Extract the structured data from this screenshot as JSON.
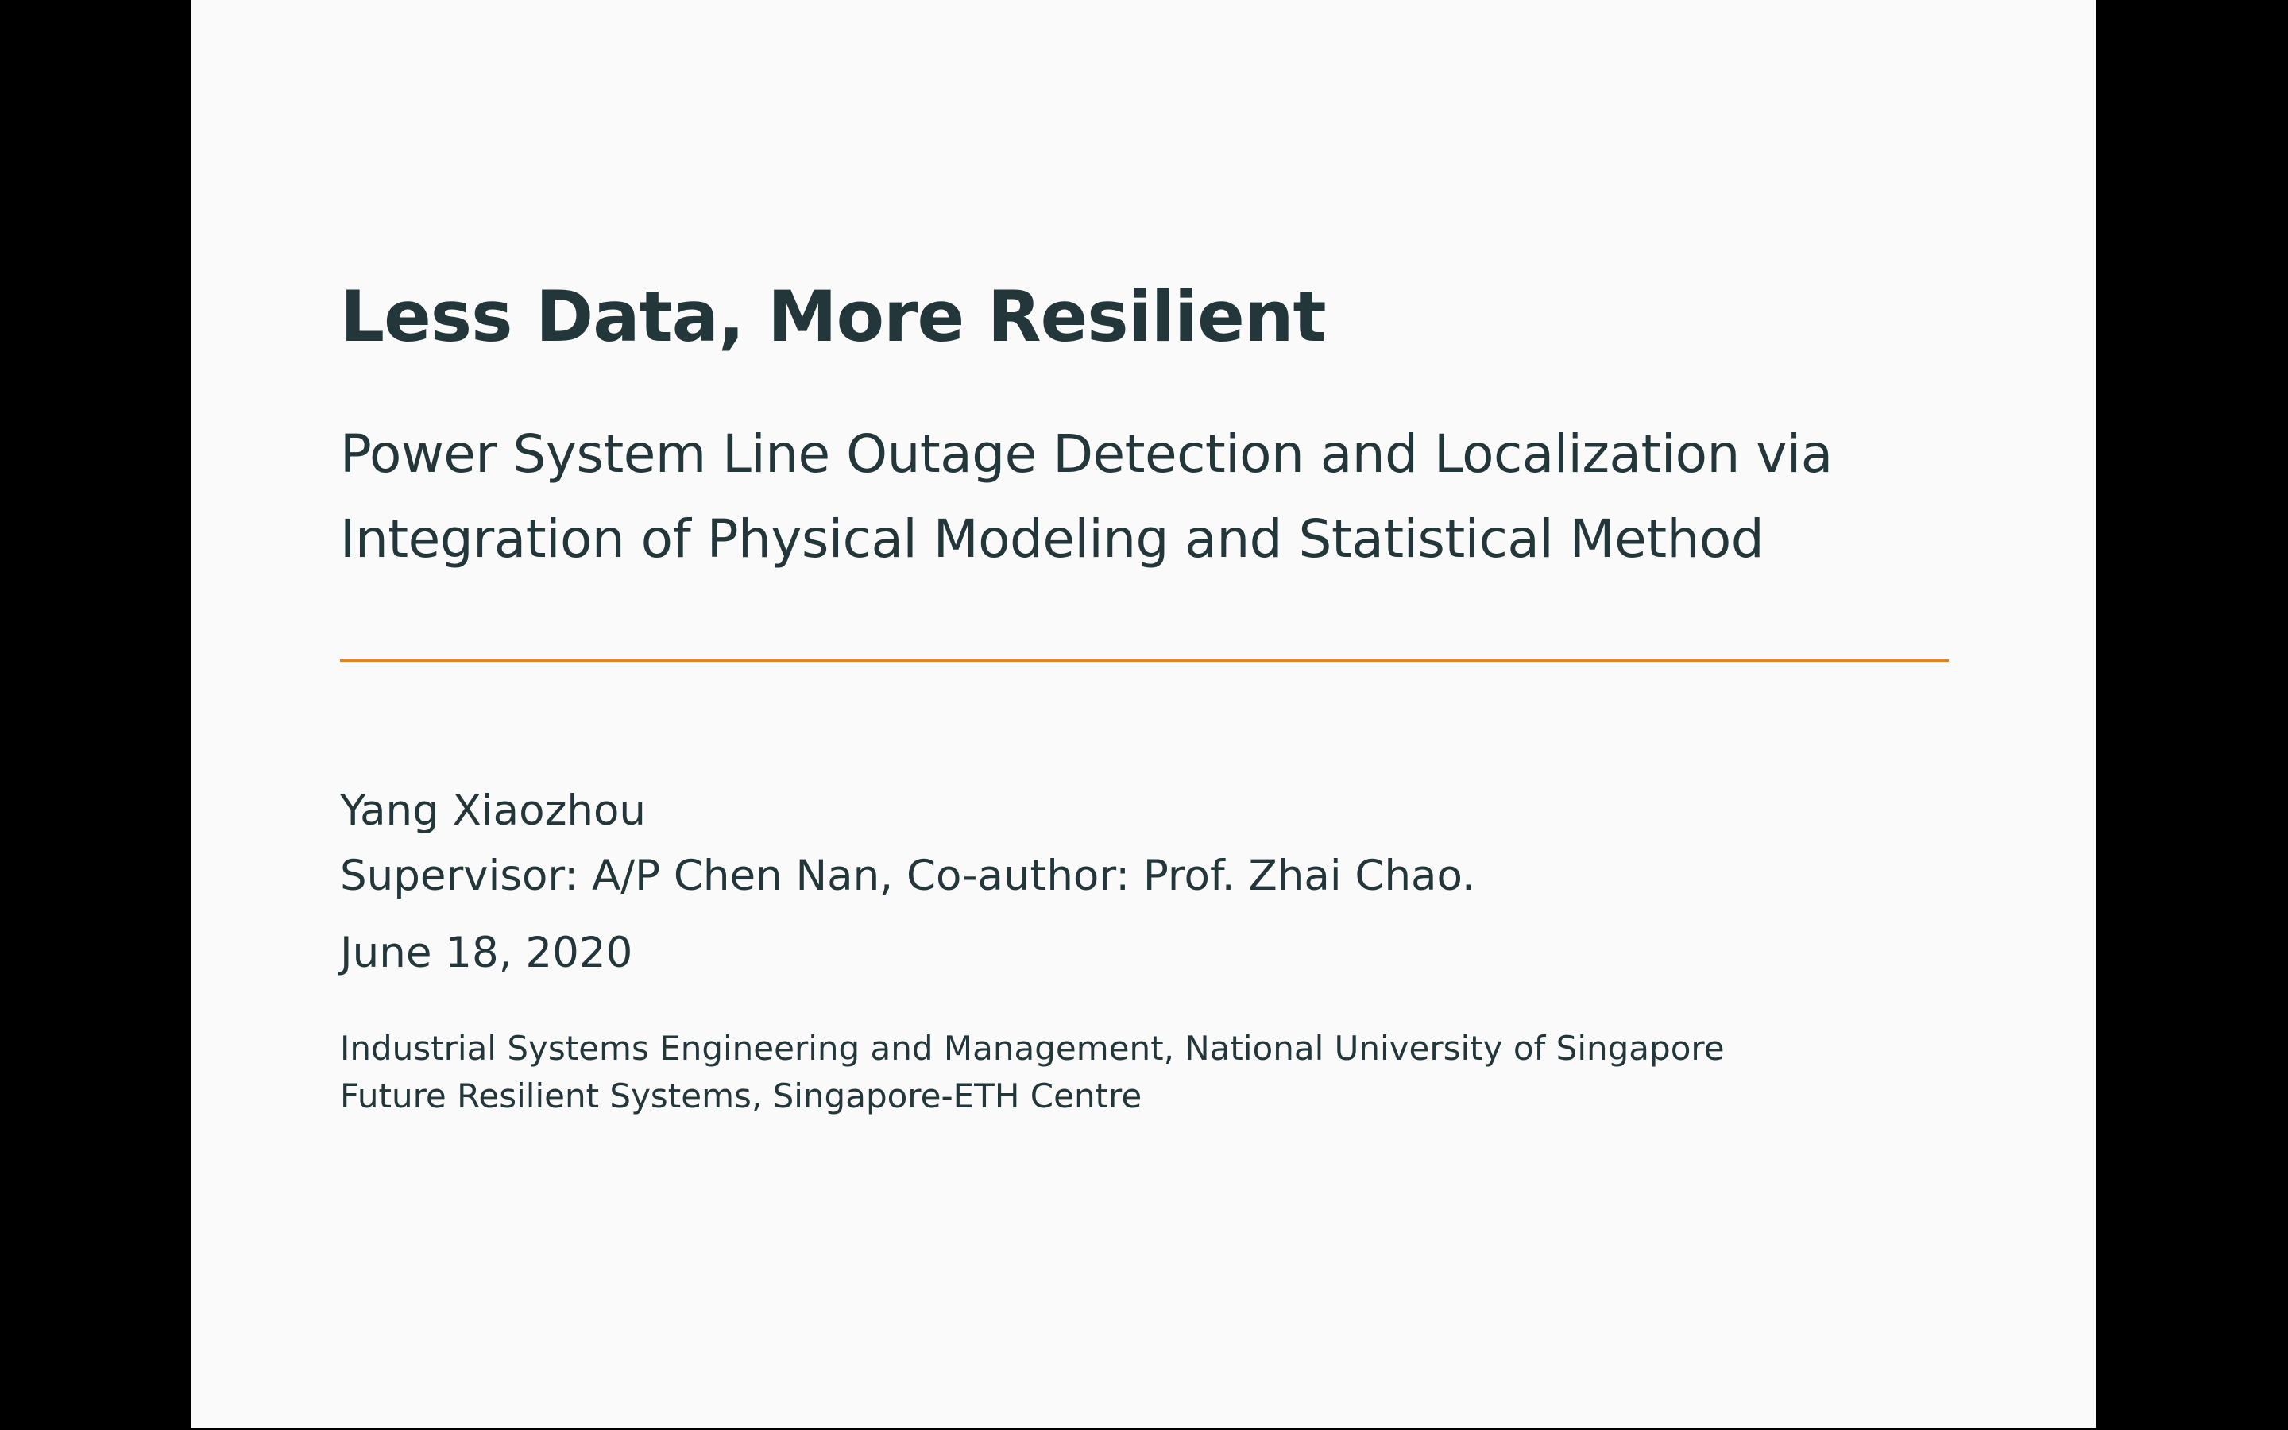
{
  "slide": {
    "title": "Less Data, More Resilient",
    "subtitle_lines": [
      "Power System Line Outage Detection and Localization via",
      "Integration of Physical Modeling and Statistical Method"
    ],
    "author": "Yang Xiaozhou",
    "supervisor": "Supervisor: A/P Chen Nan, Co-author: Prof. Zhai Chao.",
    "date": "June 18, 2020",
    "institute_lines": [
      "Industrial Systems Engineering and Management, National University of Singapore",
      "Future Resilient Systems, Singapore-ETH Centre"
    ]
  },
  "colors": {
    "background": "#fafafa",
    "text": "#23373b",
    "accent": "#eb811b",
    "letterbox": "#000000"
  }
}
